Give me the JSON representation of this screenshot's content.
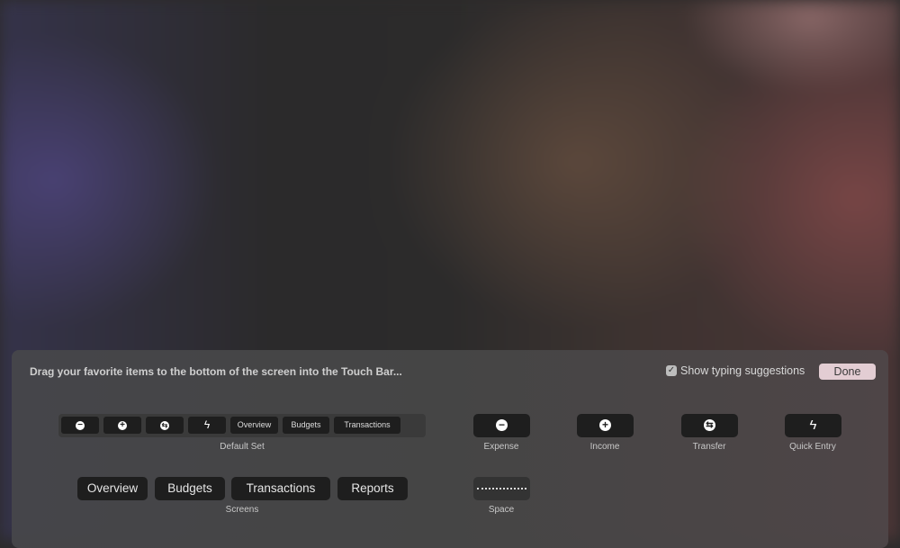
{
  "header": {
    "hint": "Drag your favorite items to the bottom of the screen into the Touch Bar...",
    "show_suggestions_label": "Show typing suggestions",
    "show_suggestions_checked": true,
    "done_label": "Done",
    "done_color": "#e3cdd3"
  },
  "default_set": {
    "label": "Default Set",
    "items": [
      {
        "icon": "minus-circle-icon",
        "glyph": "−"
      },
      {
        "icon": "plus-circle-icon",
        "glyph": "+"
      },
      {
        "icon": "transfer-icon",
        "glyph": "⇆"
      },
      {
        "icon": "bolt-icon",
        "glyph": "ϟ"
      },
      {
        "label": "Overview"
      },
      {
        "label": "Budgets"
      },
      {
        "label": "Transactions"
      }
    ]
  },
  "screens": {
    "label": "Screens",
    "items": [
      "Overview",
      "Budgets",
      "Transactions",
      "Reports"
    ]
  },
  "items": [
    {
      "label": "Expense",
      "icon": "minus-circle-icon",
      "glyph": "−"
    },
    {
      "label": "Income",
      "icon": "plus-circle-icon",
      "glyph": "+"
    },
    {
      "label": "Transfer",
      "icon": "transfer-icon",
      "glyph": "⇆"
    },
    {
      "label": "Quick Entry",
      "icon": "bolt-icon",
      "glyph": "ϟ"
    }
  ],
  "space": {
    "label": "Space"
  }
}
